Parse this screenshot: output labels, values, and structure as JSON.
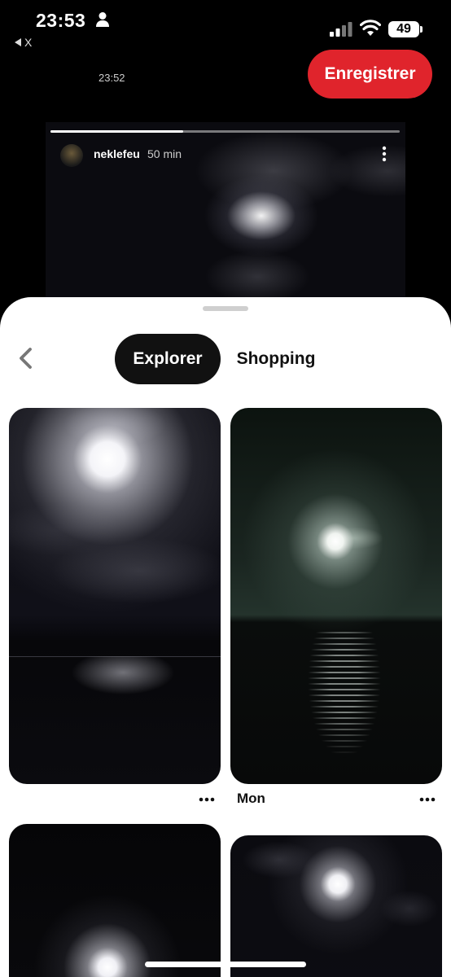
{
  "status_bar": {
    "time": "23:53",
    "back_app": "X",
    "battery": "49"
  },
  "story": {
    "posted_time": "23:52",
    "username": "neklefeu",
    "ago": "50 min",
    "progress": 0.38
  },
  "header": {
    "save_label": "Enregistrer"
  },
  "tabs": [
    {
      "label": "Explorer",
      "active": true
    },
    {
      "label": "Shopping",
      "active": false
    }
  ],
  "pins": [
    {
      "title": ""
    },
    {
      "title": "Mon"
    }
  ],
  "colors": {
    "accent": "#e0242c",
    "active_tab_bg": "#111111",
    "sheet_bg": "#ffffff"
  },
  "icons": {
    "status": [
      "person-icon",
      "signal-icon",
      "wifi-icon",
      "battery-icon"
    ],
    "story_more": "vertical-dots-icon",
    "back": "chevron-left-icon",
    "pin_more": "horizontal-dots-icon"
  }
}
